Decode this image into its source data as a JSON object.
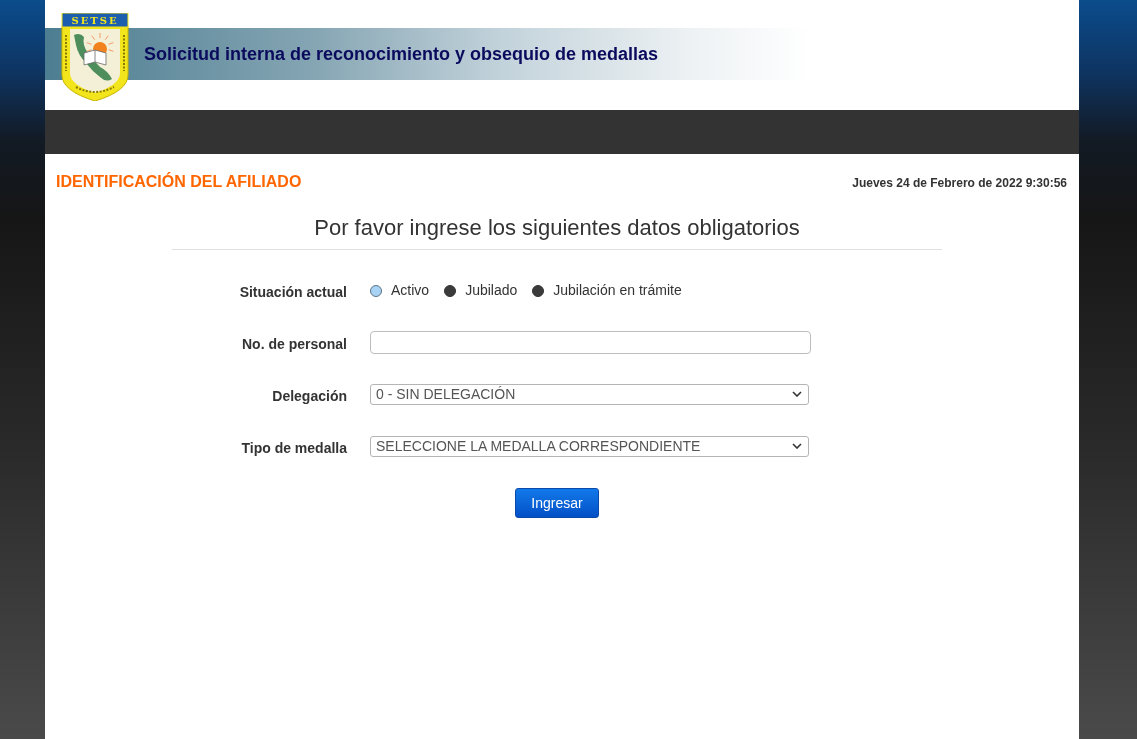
{
  "header": {
    "logo_text": "SETSE",
    "title": "Solicitud interna de reconocimiento y obsequio de medallas"
  },
  "section": {
    "title": "IDENTIFICACIÓN DEL AFILIADO",
    "datetime": "Jueves 24 de Febrero de 2022 9:30:56"
  },
  "form": {
    "heading": "Por favor ingrese los siguientes datos obligatorios",
    "fields": [
      {
        "kind": "radio",
        "label": "Situación actual",
        "options": [
          {
            "label": "Activo",
            "selected": true
          },
          {
            "label": "Jubilado",
            "selected": false
          },
          {
            "label": "Jubilación en trámite",
            "selected": false
          }
        ]
      },
      {
        "kind": "text",
        "label": "No. de personal"
      },
      {
        "kind": "select",
        "label": "Delegación",
        "value": "0 - SIN DELEGACIÓN"
      },
      {
        "kind": "select",
        "label": "Tipo de medalla",
        "value": "SELECCIONE LA MEDALLA CORRESPONDIENTE"
      }
    ],
    "submit": "Ingresar"
  }
}
